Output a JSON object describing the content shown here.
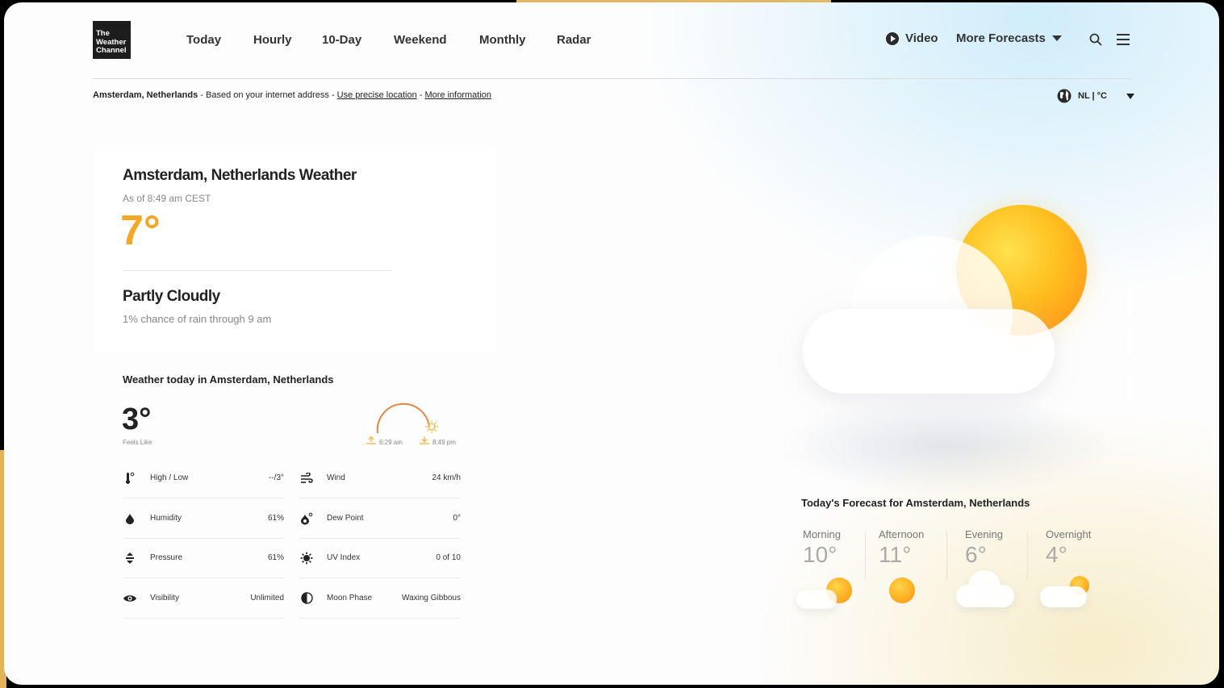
{
  "brand": {
    "logo_lines": [
      "The",
      "Weather",
      "Channel"
    ]
  },
  "nav": {
    "tabs": [
      {
        "label": "Today"
      },
      {
        "label": "Hourly"
      },
      {
        "label": "10-Day"
      },
      {
        "label": "Weekend"
      },
      {
        "label": "Monthly"
      },
      {
        "label": "Radar"
      }
    ],
    "video_label": "Video",
    "more_forecasts_label": "More Forecasts"
  },
  "location_bar": {
    "location": "Amsterdam, Netherlands",
    "based_on": " - Based on your internet address - ",
    "precise_link": "Use precise location",
    "separator": " - ",
    "more_info_link": "More information",
    "unit_label": "NL | °C"
  },
  "current": {
    "title": "Amsterdam, Netherlands Weather",
    "as_of": "As of 8:49 am CEST",
    "temperature": "7°",
    "condition": "Partly Cloudly",
    "rain_chance": "1% chance of rain through 9 am"
  },
  "today_details": {
    "title": "Weather today in Amsterdam, Netherlands",
    "feels_like_value": "3°",
    "feels_like_label": "Feels Like",
    "sunrise": "6:29 am",
    "sunset": "8:49 pm",
    "rows": [
      {
        "label": "High / Low",
        "value": "--/3°",
        "icon": "thermometer-icon"
      },
      {
        "label": "Wind",
        "value": "24 km/h",
        "icon": "wind-icon"
      },
      {
        "label": "Humidity",
        "value": "61%",
        "icon": "droplet-icon"
      },
      {
        "label": "Dew Point",
        "value": "0°",
        "icon": "dew-point-icon"
      },
      {
        "label": "Pressure",
        "value": "61%",
        "icon": "pressure-icon"
      },
      {
        "label": "UV Index",
        "value": "0 of 10",
        "icon": "uv-icon"
      },
      {
        "label": "Visibility",
        "value": "Unlimited",
        "icon": "eye-icon"
      },
      {
        "label": "Moon Phase",
        "value": "Waxing Gibbous",
        "icon": "moon-icon"
      }
    ]
  },
  "forecast": {
    "title": "Today's Forecast for Amsterdam, Netherlands",
    "periods": [
      {
        "name": "Morning",
        "temp": "10°",
        "icon": "partly-sunny-icon"
      },
      {
        "name": "Afternoon",
        "temp": "11°",
        "icon": "sun-icon"
      },
      {
        "name": "Evening",
        "temp": "6°",
        "icon": "cloud-icon"
      },
      {
        "name": "Overnight",
        "temp": "4°",
        "icon": "partly-cloudy-icon"
      }
    ]
  },
  "colors": {
    "accent_temp": "#f5a623",
    "sun_orange": "#ff8a1a",
    "logo_bg": "#1d1d1d"
  }
}
